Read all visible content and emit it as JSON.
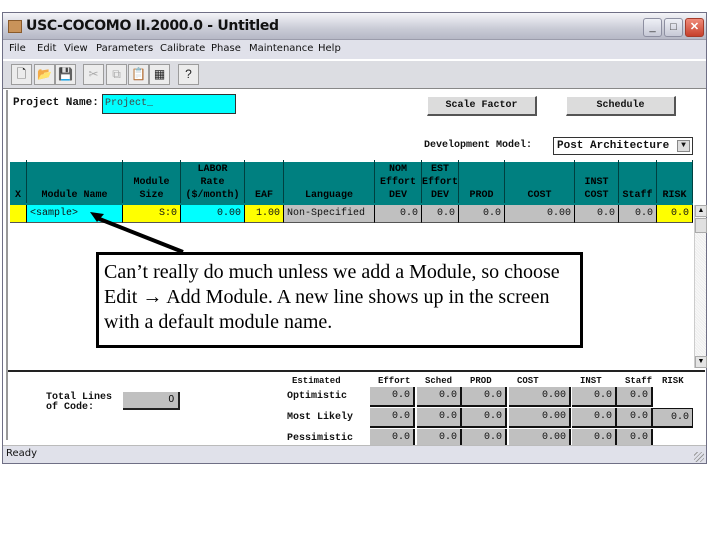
{
  "window": {
    "title": "USC-COCOMO II.2000.0 - Untitled",
    "controls": {
      "minimize": "_",
      "maximize": "□",
      "close": "✕"
    }
  },
  "menu": [
    "File",
    "Edit",
    "View",
    "Parameters",
    "Calibrate",
    "Phase",
    "Maintenance",
    "Help"
  ],
  "toolbar": {
    "icons": [
      "new-icon",
      "open-icon",
      "save-icon",
      "cut-icon",
      "copy-icon",
      "paste-icon",
      "add-module-icon",
      "help-icon"
    ],
    "glyphs": [
      "🗋",
      "📂",
      "💾",
      "✂",
      "⧉",
      "📋",
      "▦",
      "?"
    ]
  },
  "project": {
    "label": "Project Name:",
    "value": "Project_"
  },
  "buttons": {
    "scale_factor": "Scale Factor",
    "schedule": "Schedule"
  },
  "dev_model": {
    "label": "Development Model:",
    "value": "Post Architecture",
    "arrow": "▼"
  },
  "grid": {
    "headers": [
      [
        "",
        "",
        "X"
      ],
      [
        "",
        "",
        "Module Name"
      ],
      [
        "",
        "Module",
        "Size"
      ],
      [
        "LABOR",
        "Rate",
        "($/month)"
      ],
      [
        "",
        "",
        "EAF"
      ],
      [
        "",
        "",
        "Language"
      ],
      [
        "NOM",
        "Effort",
        "DEV"
      ],
      [
        "EST",
        "Effort",
        "DEV"
      ],
      [
        "",
        "",
        "PROD"
      ],
      [
        "",
        "",
        "COST"
      ],
      [
        "",
        "INST",
        "COST"
      ],
      [
        "",
        "",
        "Staff"
      ],
      [
        "",
        "",
        "RISK"
      ]
    ],
    "row": [
      "",
      "<sample>",
      "S:0",
      "0.00",
      "1.00",
      "Non-Specified",
      "0.0",
      "0.0",
      "0.0",
      "0.00",
      "0.0",
      "0.0",
      "0.0"
    ]
  },
  "callout": {
    "text": "Can’t really do much unless we add a Module, so choose Edit → Add Module. A new line shows up in the screen with a default module name."
  },
  "totals": {
    "label_line1": "Total Lines",
    "label_line2": "of Code:",
    "value": "0"
  },
  "estimates": {
    "headers": [
      "Estimated",
      "Effort",
      "Sched",
      "PROD",
      "COST",
      "INST",
      "Staff",
      "RISK"
    ],
    "rows": [
      {
        "label": "Optimistic",
        "values": [
          "0.0",
          "0.0",
          "0.0",
          "0.00",
          "0.0",
          "0.0"
        ],
        "risk": ""
      },
      {
        "label": "Most Likely",
        "values": [
          "0.0",
          "0.0",
          "0.0",
          "0.00",
          "0.0",
          "0.0"
        ],
        "risk": "0.0"
      },
      {
        "label": "Pessimistic",
        "values": [
          "0.0",
          "0.0",
          "0.0",
          "0.00",
          "0.0",
          "0.0"
        ],
        "risk": ""
      }
    ]
  },
  "status": {
    "text": "Ready"
  },
  "colors": {
    "grid_header": "#008080",
    "input_cyan": "#00ffff",
    "input_yellow": "#ffff00",
    "readonly_gray": "#c0c0c0"
  }
}
